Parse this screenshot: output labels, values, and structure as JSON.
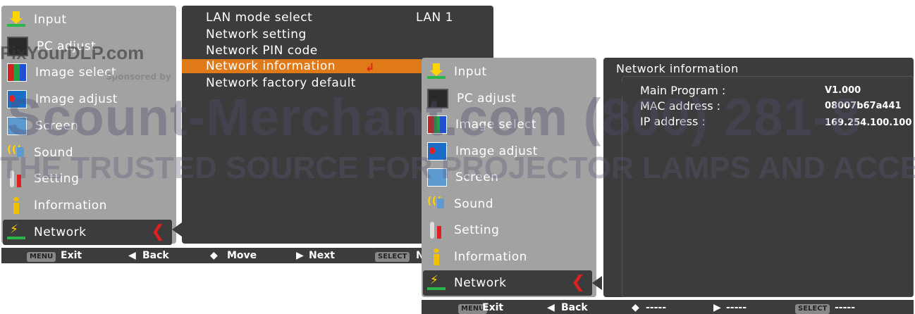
{
  "menu_left": {
    "items": [
      {
        "label": "Input",
        "icon": "input-icon"
      },
      {
        "label": "PC adjust",
        "icon": "pc-adjust-icon"
      },
      {
        "label": "Image select",
        "icon": "image-select-icon"
      },
      {
        "label": "Image adjust",
        "icon": "image-adjust-icon"
      },
      {
        "label": "Screen",
        "icon": "screen-icon"
      },
      {
        "label": "Sound",
        "icon": "sound-icon"
      },
      {
        "label": "Setting",
        "icon": "setting-icon"
      },
      {
        "label": "Information",
        "icon": "information-icon"
      },
      {
        "label": "Network",
        "icon": "network-icon"
      }
    ]
  },
  "submenu": {
    "items": [
      {
        "label": "LAN mode select",
        "value": "LAN 1"
      },
      {
        "label": "Network setting"
      },
      {
        "label": "Network PIN code"
      },
      {
        "label": "Network information"
      },
      {
        "label": "Network factory default"
      }
    ]
  },
  "bar1": {
    "menu_key": "MENU",
    "exit": "Exit",
    "back": "Back",
    "move": "Move",
    "next": "Next",
    "select_key": "SELECT",
    "select": "N"
  },
  "menu_right": {
    "items": [
      {
        "label": "Input",
        "icon": "input-icon"
      },
      {
        "label": "PC adjust",
        "icon": "pc-adjust-icon"
      },
      {
        "label": "Image select",
        "icon": "image-select-icon"
      },
      {
        "label": "Image adjust",
        "icon": "image-adjust-icon"
      },
      {
        "label": "Screen",
        "icon": "screen-icon"
      },
      {
        "label": "Sound",
        "icon": "sound-icon"
      },
      {
        "label": "Setting",
        "icon": "setting-icon"
      },
      {
        "label": "Information",
        "icon": "information-icon"
      },
      {
        "label": "Network",
        "icon": "network-icon"
      }
    ]
  },
  "info": {
    "title": "Network information",
    "rows": [
      {
        "label": "Main Program :",
        "value": "V1.000"
      },
      {
        "label": "MAC address :",
        "value": "08007b67a441"
      },
      {
        "label": "IP address :",
        "value": "169.254.100.100"
      }
    ]
  },
  "bar2": {
    "menu_key": "MENU",
    "exit": "Exit",
    "back": "Back",
    "move": "-----",
    "next": "-----",
    "select_key": "SELECT",
    "select": "-----"
  },
  "watermark": {
    "line1": "FixYourDLP.com",
    "line1b": "Sponsored by",
    "line2": "Scount-Merchant.com (800) 281-8",
    "line3": "THE TRUSTED SOURCE FOR PROJECTOR LAMPS AND ACCESSORIES"
  },
  "colors": {
    "highlight": "#e07a18",
    "panel": "#3c3c3c",
    "menu": "#a2a2a2",
    "accent": "#e02020"
  }
}
